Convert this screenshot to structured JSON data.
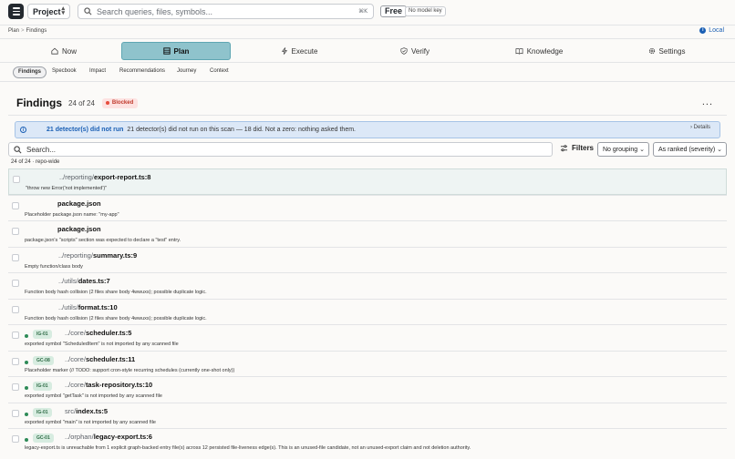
{
  "topbar": {
    "project_label": "Project",
    "search_placeholder": "Search queries, files, symbols...",
    "shortcut": "⌘K",
    "plan_badge": "Free",
    "model_badge": "No model key"
  },
  "breadcrumb": {
    "items": [
      "Plan",
      "Findings"
    ],
    "separator": ">"
  },
  "environment": {
    "label": "Local",
    "icon": "info-icon"
  },
  "nav": {
    "tabs": [
      {
        "label": "Now",
        "icon": "home-icon"
      },
      {
        "label": "Plan",
        "icon": "grid-icon",
        "active": true
      },
      {
        "label": "Execute",
        "icon": "lightning-icon"
      },
      {
        "label": "Verify",
        "icon": "shield-check-icon"
      },
      {
        "label": "Knowledge",
        "icon": "book-icon"
      },
      {
        "label": "Settings",
        "icon": "gear-icon"
      }
    ]
  },
  "subtabs": [
    "Findings",
    "Specbook",
    "Impact",
    "Recommendations",
    "Journey",
    "Context"
  ],
  "header": {
    "title": "Findings",
    "count": "24 of 24",
    "status": "Blocked",
    "more": "..."
  },
  "banner": {
    "lead": "21 detector(s) did not run",
    "message": "21 detector(s) did not run on this scan — 18 did. Not a zero: nothing asked them.",
    "details": "Details"
  },
  "filters": {
    "search_placeholder": "Search...",
    "filters_label": "Filters",
    "grouping": "No grouping",
    "ranking": "As ranked (severity)"
  },
  "scope_text": "24 of 24 · repo-wide",
  "findings": [
    {
      "dir": "../reporting/",
      "file": "export-report.ts:8",
      "desc": "\"throw new Error('not implemented')\"",
      "code": "",
      "dot": false
    },
    {
      "dir": "",
      "file": "package.json",
      "desc": "Placeholder package.json name: \"my-app\"",
      "code": "",
      "dot": false
    },
    {
      "dir": "",
      "file": "package.json",
      "desc": "package.json's \"scripts\" section was expected to declare a \"test\" entry.",
      "code": "",
      "dot": false
    },
    {
      "dir": "../reporting/",
      "file": "summary.ts:9",
      "desc": "Empty function/class body",
      "code": "",
      "dot": false
    },
    {
      "dir": "../utils/",
      "file": "dates.ts:7",
      "desc": "Function body hash collision (2 files share body 4wwuxs); possible duplicate logic.",
      "code": "",
      "dot": false
    },
    {
      "dir": "../utils/",
      "file": "format.ts:10",
      "desc": "Function body hash collision (2 files share body 4wwuxs); possible duplicate logic.",
      "code": "",
      "dot": false
    },
    {
      "dir": "../core/",
      "file": "scheduler.ts:5",
      "desc": "exported symbol \"ScheduledItem\" is not imported by any scanned file",
      "code": "IG-01",
      "dot": true
    },
    {
      "dir": "../core/",
      "file": "scheduler.ts:11",
      "desc": "Placeholder marker (// TODO: support cron-style recurring schedules (currently one-shot only))",
      "code": "GC-08",
      "dot": true
    },
    {
      "dir": "../core/",
      "file": "task-repository.ts:10",
      "desc": "exported symbol \"getTask\" is not imported by any scanned file",
      "code": "IG-01",
      "dot": true
    },
    {
      "dir": "src/",
      "file": "index.ts:5",
      "desc": "exported symbol \"main\" is not imported by any scanned file",
      "code": "IG-01",
      "dot": true
    },
    {
      "dir": "../orphan/",
      "file": "legacy-export.ts:6",
      "desc": "legacy-export.ts is unreachable from 1 explicit graph-backed entry file(s) across 12 persisted file-liveness edge(s). This is an unused-file candidate, not an unused-export claim and not deletion authority.",
      "code": "GC-01",
      "dot": true
    }
  ]
}
